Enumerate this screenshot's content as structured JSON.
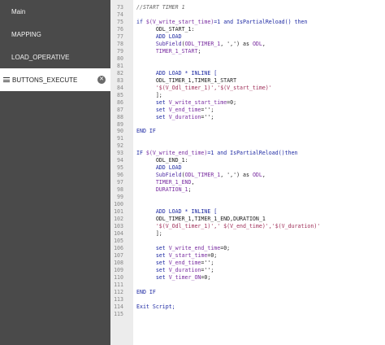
{
  "sidebar": {
    "items": [
      {
        "label": "Main"
      },
      {
        "label": "MAPPING"
      },
      {
        "label": "LOAD_OPERATIVE"
      },
      {
        "label": "BUTTONS_EXECUTE"
      }
    ]
  },
  "editor": {
    "lines": [
      {
        "n": "73",
        "segs": [
          [
            "cmt",
            "//START TIMER 1"
          ]
        ]
      },
      {
        "n": "74",
        "segs": []
      },
      {
        "n": "75",
        "segs": [
          [
            "kw",
            "if "
          ],
          [
            "var",
            "$(V_write_start_time)"
          ],
          [
            "kw",
            "=1 and IsPartialReload() then"
          ]
        ]
      },
      {
        "n": "76",
        "segs": [
          [
            "txt",
            "      ODL_START_1:"
          ]
        ]
      },
      {
        "n": "77",
        "segs": [
          [
            "kw",
            "      ADD LOAD"
          ]
        ]
      },
      {
        "n": "78",
        "segs": [
          [
            "fn",
            "      SubField"
          ],
          [
            "txt",
            "("
          ],
          [
            "var",
            "ODL_TIMER_1"
          ],
          [
            "txt",
            ", ','"
          ],
          [
            "txt",
            ") as "
          ],
          [
            "var",
            "ODL"
          ],
          [
            "txt",
            ","
          ]
        ]
      },
      {
        "n": "79",
        "segs": [
          [
            "var",
            "      TIMER_1_START"
          ],
          [
            "txt",
            ";"
          ]
        ]
      },
      {
        "n": "80",
        "segs": []
      },
      {
        "n": "81",
        "segs": []
      },
      {
        "n": "82",
        "segs": [
          [
            "kw",
            "      ADD LOAD * INLINE ["
          ]
        ]
      },
      {
        "n": "83",
        "segs": [
          [
            "txt",
            "      ODL_TIMER_1,TIMER_1_START"
          ]
        ]
      },
      {
        "n": "84",
        "segs": [
          [
            "str",
            "      '$(V_Odl_timer_1)','$(V_start_time)'"
          ]
        ]
      },
      {
        "n": "85",
        "segs": [
          [
            "txt",
            "      ];"
          ]
        ]
      },
      {
        "n": "86",
        "segs": [
          [
            "kw",
            "      set "
          ],
          [
            "var",
            "V_write_start_time"
          ],
          [
            "txt",
            "=0;"
          ]
        ]
      },
      {
        "n": "87",
        "segs": [
          [
            "kw",
            "      set "
          ],
          [
            "var",
            "V_end_time"
          ],
          [
            "txt",
            "='';"
          ]
        ]
      },
      {
        "n": "88",
        "segs": [
          [
            "kw",
            "      set "
          ],
          [
            "var",
            "V_duration"
          ],
          [
            "txt",
            "='';"
          ]
        ]
      },
      {
        "n": "89",
        "segs": []
      },
      {
        "n": "90",
        "segs": [
          [
            "kw",
            "END IF"
          ]
        ]
      },
      {
        "n": "91",
        "segs": []
      },
      {
        "n": "92",
        "segs": []
      },
      {
        "n": "93",
        "segs": [
          [
            "kw",
            "IF "
          ],
          [
            "var",
            "$(V_write_end_time)"
          ],
          [
            "kw",
            "=1 and IsPartialReload()then"
          ]
        ]
      },
      {
        "n": "94",
        "segs": [
          [
            "txt",
            "      ODL_END_1:"
          ]
        ]
      },
      {
        "n": "95",
        "segs": [
          [
            "kw",
            "      ADD LOAD"
          ]
        ]
      },
      {
        "n": "96",
        "segs": [
          [
            "fn",
            "      SubField"
          ],
          [
            "txt",
            "("
          ],
          [
            "var",
            "ODL_TIMER_1"
          ],
          [
            "txt",
            ", ','"
          ],
          [
            "txt",
            ") as "
          ],
          [
            "var",
            "ODL"
          ],
          [
            "txt",
            ","
          ]
        ]
      },
      {
        "n": "97",
        "segs": [
          [
            "var",
            "      TIMER_1_END"
          ],
          [
            "txt",
            ","
          ]
        ]
      },
      {
        "n": "98",
        "segs": [
          [
            "var",
            "      DURATION_1"
          ],
          [
            "txt",
            ";"
          ]
        ]
      },
      {
        "n": "99",
        "segs": []
      },
      {
        "n": "100",
        "segs": []
      },
      {
        "n": "101",
        "segs": [
          [
            "kw",
            "      ADD LOAD * INLINE ["
          ]
        ]
      },
      {
        "n": "102",
        "segs": [
          [
            "txt",
            "      ODL_TIMER_1,TIMER_1_END,DURATION_1"
          ]
        ]
      },
      {
        "n": "103",
        "segs": [
          [
            "str",
            "      '$(V_Odl_timer_1)',' $(V_end_time)','$(V_duration)'"
          ]
        ]
      },
      {
        "n": "104",
        "segs": [
          [
            "txt",
            "      ];"
          ]
        ]
      },
      {
        "n": "105",
        "segs": []
      },
      {
        "n": "106",
        "segs": [
          [
            "kw",
            "      set "
          ],
          [
            "var",
            "V_write_end_time"
          ],
          [
            "txt",
            "=0;"
          ]
        ]
      },
      {
        "n": "107",
        "segs": [
          [
            "kw",
            "      set "
          ],
          [
            "var",
            "V_start_time"
          ],
          [
            "txt",
            "=0;"
          ]
        ]
      },
      {
        "n": "108",
        "segs": [
          [
            "kw",
            "      set "
          ],
          [
            "var",
            "V_end_time"
          ],
          [
            "txt",
            "='';"
          ]
        ]
      },
      {
        "n": "109",
        "segs": [
          [
            "kw",
            "      set "
          ],
          [
            "var",
            "V_duration"
          ],
          [
            "txt",
            "='';"
          ]
        ]
      },
      {
        "n": "110",
        "segs": [
          [
            "kw",
            "      set "
          ],
          [
            "var",
            "V_timer_ON"
          ],
          [
            "txt",
            "=0;"
          ]
        ]
      },
      {
        "n": "111",
        "segs": []
      },
      {
        "n": "112",
        "segs": [
          [
            "kw",
            "END IF"
          ]
        ]
      },
      {
        "n": "113",
        "segs": []
      },
      {
        "n": "114",
        "segs": [
          [
            "kw",
            "Exit Script;"
          ]
        ]
      },
      {
        "n": "115",
        "segs": []
      }
    ]
  },
  "icons": {
    "active_item": "hamburger-icon",
    "close": "close-icon"
  },
  "colors": {
    "sidebar_bg": "#4a4a4a",
    "keyword": "#1e2aa3",
    "variable": "#7a2ea1",
    "string": "#a0305a"
  }
}
